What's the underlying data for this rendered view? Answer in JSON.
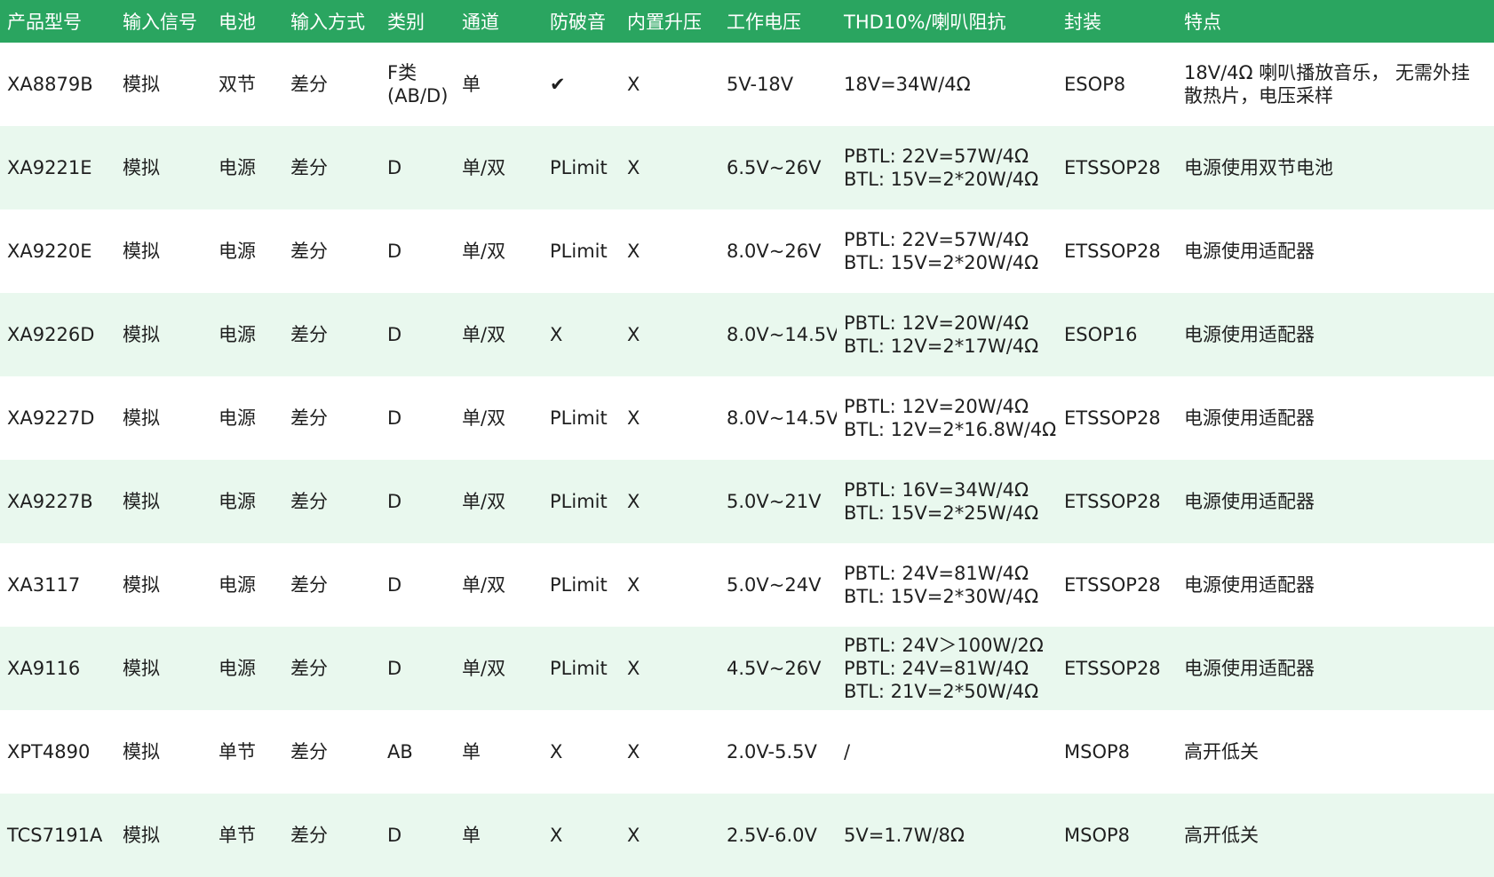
{
  "table": {
    "headers": [
      "产品型号",
      "输入信号",
      "电池",
      "输入方式",
      "类别",
      "通道",
      "防破音",
      "内置升压",
      "工作电压",
      "THD10%/喇叭阻抗",
      "封装",
      "特点"
    ],
    "rows": [
      {
        "model": "XA8879B",
        "signal": "模拟",
        "battery": "双节",
        "input": "差分",
        "class_lines": [
          "F类",
          "(AB/D)"
        ],
        "channel": "单",
        "anti_clip": "✔",
        "boost": "X",
        "voltage": "5V-18V",
        "thd_lines": [
          "18V=34W/4Ω"
        ],
        "package": "ESOP8",
        "feature_lines": [
          "18V/4Ω 喇叭播放音乐， 无需外挂",
          "散热片，电压采样"
        ]
      },
      {
        "model": "XA9221E",
        "signal": "模拟",
        "battery": "电源",
        "input": "差分",
        "class_lines": [
          "D"
        ],
        "channel": "单/双",
        "anti_clip": "PLimit",
        "boost": "X",
        "voltage": "6.5V~26V",
        "thd_lines": [
          "PBTL: 22V=57W/4Ω",
          "BTL: 15V=2*20W/4Ω"
        ],
        "package": "ETSSOP28",
        "feature_lines": [
          "电源使用双节电池"
        ]
      },
      {
        "model": "XA9220E",
        "signal": "模拟",
        "battery": "电源",
        "input": "差分",
        "class_lines": [
          "D"
        ],
        "channel": "单/双",
        "anti_clip": "PLimit",
        "boost": "X",
        "voltage": "8.0V~26V",
        "thd_lines": [
          "PBTL: 22V=57W/4Ω",
          "BTL: 15V=2*20W/4Ω"
        ],
        "package": "ETSSOP28",
        "feature_lines": [
          "电源使用适配器"
        ]
      },
      {
        "model": "XA9226D",
        "signal": "模拟",
        "battery": "电源",
        "input": "差分",
        "class_lines": [
          "D"
        ],
        "channel": "单/双",
        "anti_clip": "X",
        "boost": "X",
        "voltage": "8.0V~14.5V",
        "thd_lines": [
          "PBTL: 12V=20W/4Ω",
          "BTL: 12V=2*17W/4Ω"
        ],
        "package": "ESOP16",
        "feature_lines": [
          "电源使用适配器"
        ]
      },
      {
        "model": "XA9227D",
        "signal": "模拟",
        "battery": "电源",
        "input": "差分",
        "class_lines": [
          "D"
        ],
        "channel": "单/双",
        "anti_clip": "PLimit",
        "boost": "X",
        "voltage": "8.0V~14.5V",
        "thd_lines": [
          "PBTL: 12V=20W/4Ω",
          "BTL: 12V=2*16.8W/4Ω"
        ],
        "package": "ETSSOP28",
        "feature_lines": [
          "电源使用适配器"
        ]
      },
      {
        "model": "XA9227B",
        "signal": "模拟",
        "battery": "电源",
        "input": "差分",
        "class_lines": [
          "D"
        ],
        "channel": "单/双",
        "anti_clip": "PLimit",
        "boost": "X",
        "voltage": "5.0V~21V",
        "thd_lines": [
          "PBTL: 16V=34W/4Ω",
          "BTL: 15V=2*25W/4Ω"
        ],
        "package": "ETSSOP28",
        "feature_lines": [
          "电源使用适配器"
        ]
      },
      {
        "model": "XA3117",
        "signal": "模拟",
        "battery": "电源",
        "input": "差分",
        "class_lines": [
          "D"
        ],
        "channel": "单/双",
        "anti_clip": "PLimit",
        "boost": "X",
        "voltage": "5.0V~24V",
        "thd_lines": [
          "PBTL: 24V=81W/4Ω",
          "BTL: 15V=2*30W/4Ω"
        ],
        "package": "ETSSOP28",
        "feature_lines": [
          "电源使用适配器"
        ]
      },
      {
        "model": "XA9116",
        "signal": "模拟",
        "battery": "电源",
        "input": "差分",
        "class_lines": [
          "D"
        ],
        "channel": "单/双",
        "anti_clip": "PLimit",
        "boost": "X",
        "voltage": "4.5V~26V",
        "thd_lines": [
          "PBTL: 24V＞100W/2Ω",
          "PBTL: 24V=81W/4Ω",
          "BTL: 21V=2*50W/4Ω"
        ],
        "package": "ETSSOP28",
        "feature_lines": [
          "电源使用适配器"
        ]
      },
      {
        "model": "XPT4890",
        "signal": "模拟",
        "battery": "单节",
        "input": "差分",
        "class_lines": [
          "AB"
        ],
        "channel": "单",
        "anti_clip": "X",
        "boost": "X",
        "voltage": "2.0V-5.5V",
        "thd_lines": [
          "/"
        ],
        "package": "MSOP8",
        "feature_lines": [
          "高开低关"
        ]
      },
      {
        "model": "TCS7191A",
        "signal": "模拟",
        "battery": "单节",
        "input": "差分",
        "class_lines": [
          "D"
        ],
        "channel": "单",
        "anti_clip": "X",
        "boost": "X",
        "voltage": "2.5V-6.0V",
        "thd_lines": [
          "5V=1.7W/8Ω"
        ],
        "package": "MSOP8",
        "feature_lines": [
          "高开低关"
        ]
      }
    ]
  }
}
